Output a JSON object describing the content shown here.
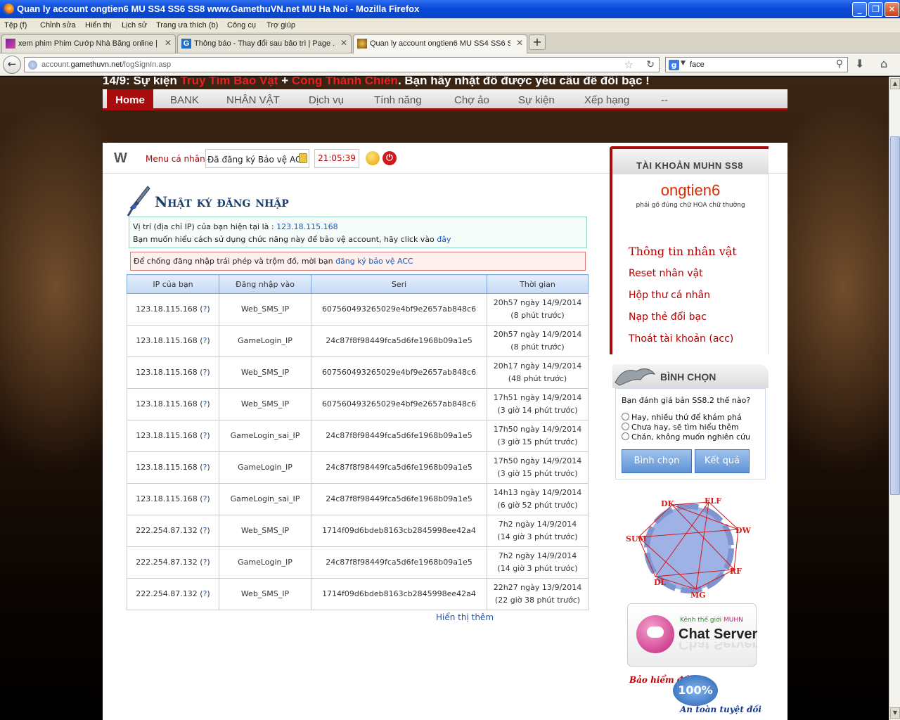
{
  "window": {
    "title": "Quan ly account ongtien6 MU SS4 SS6 SS8 www.GamethuVN.net MU Ha Noi - Mozilla Firefox",
    "min": "_",
    "max": "❐",
    "close": "✕"
  },
  "menubar": [
    "Tệp (f)",
    "Chỉnh sửa",
    "Hiển thị",
    "Lịch sử",
    "Trang ưa thích (b)",
    "Công cụ",
    "Trợ giúp"
  ],
  "tabs": [
    {
      "label": "xem phim Phim Cướp Nhà Băng online | T...",
      "close": "✕"
    },
    {
      "label": "Thông báo - Thay đổi sau bảo trì | Page ...",
      "close": "✕"
    },
    {
      "label": "Quan ly account ongtien6 MU SS4 SS6 SS...",
      "close": "✕"
    }
  ],
  "newtab": "+",
  "address": {
    "prefix": "account.",
    "domain": "gamethuvn.net",
    "path": "/logSignIn.asp"
  },
  "search": {
    "engine": "g",
    "query": "face"
  },
  "page": {
    "announce": {
      "part1": "14/9: Sự kiện ",
      "red1": "Truy Tìm Bảo Vật",
      "part2": " + ",
      "red2": "Công Thành Chiến",
      "part3": ". Bạn hãy nhặt đồ được yêu cầu để đổi bạc !"
    },
    "nav": [
      "Home",
      "BANK",
      "NHÂN VẬT",
      "Dịch vụ",
      "Tính năng",
      "Chợ ảo",
      "Sự kiện",
      "Xếp hạng",
      "--"
    ],
    "toolbar": {
      "logo": "W",
      "menu": "Menu cá nhân",
      "registered": "Đã đăng ký Bảo vệ ACC",
      "time": "21:05:39"
    },
    "section_title": "Nhật ký đăng nhập",
    "info": {
      "ip_text": "Vị trí (địa chỉ IP) của bạn hiện tại là : ",
      "ip": "123.18.115.168",
      "help_text": "Bạn muốn hiểu cách sử dụng chức năng này để bảo vệ account, hãy click vào ",
      "help_link": "đây",
      "warn_text": "Để chống đăng nhập trái phép và trộm đồ, mời bạn ",
      "warn_link": "đăng ký bảo vệ ACC"
    },
    "table": {
      "headers": [
        "IP của bạn",
        "Đăng nhập vào",
        "Seri",
        "Thời gian"
      ],
      "rows": [
        {
          "ip": "123.18.115.168",
          "q": "?",
          "target": "Web_SMS_IP",
          "seri": "607560493265029e4bf9e2657ab848c6",
          "time": "20h57 ngày 14/9/2014",
          "ago": "(8 phút trước)"
        },
        {
          "ip": "123.18.115.168",
          "q": "?",
          "target": "GameLogin_IP",
          "seri": "24c87f8f98449fca5d6fe1968b09a1e5",
          "time": "20h57 ngày 14/9/2014",
          "ago": "(8 phút trước)"
        },
        {
          "ip": "123.18.115.168",
          "q": "?",
          "target": "Web_SMS_IP",
          "seri": "607560493265029e4bf9e2657ab848c6",
          "time": "20h17 ngày 14/9/2014",
          "ago": "(48 phút trước)"
        },
        {
          "ip": "123.18.115.168",
          "q": "?",
          "target": "Web_SMS_IP",
          "seri": "607560493265029e4bf9e2657ab848c6",
          "time": "17h51 ngày 14/9/2014",
          "ago": "(3 giờ 14 phút trước)"
        },
        {
          "ip": "123.18.115.168",
          "q": "?",
          "target": "GameLogin_sai_IP",
          "seri": "24c87f8f98449fca5d6fe1968b09a1e5",
          "time": "17h50 ngày 14/9/2014",
          "ago": "(3 giờ 15 phút trước)"
        },
        {
          "ip": "123.18.115.168",
          "q": "?",
          "target": "GameLogin_IP",
          "seri": "24c87f8f98449fca5d6fe1968b09a1e5",
          "time": "17h50 ngày 14/9/2014",
          "ago": "(3 giờ 15 phút trước)"
        },
        {
          "ip": "123.18.115.168",
          "q": "?",
          "target": "GameLogin_sai_IP",
          "seri": "24c87f8f98449fca5d6fe1968b09a1e5",
          "time": "14h13 ngày 14/9/2014",
          "ago": "(6 giờ 52 phút trước)"
        },
        {
          "ip": "222.254.87.132",
          "q": "?",
          "target": "Web_SMS_IP",
          "seri": "1714f09d6bdeb8163cb2845998ee42a4",
          "time": "7h2 ngày 14/9/2014",
          "ago": "(14 giờ 3 phút trước)"
        },
        {
          "ip": "222.254.87.132",
          "q": "?",
          "target": "GameLogin_IP",
          "seri": "24c87f8f98449fca5d6fe1968b09a1e5",
          "time": "7h2 ngày 14/9/2014",
          "ago": "(14 giờ 3 phút trước)"
        },
        {
          "ip": "222.254.87.132",
          "q": "?",
          "target": "Web_SMS_IP",
          "seri": "1714f09d6bdeb8163cb2845998ee42a4",
          "time": "22h27 ngày 13/9/2014",
          "ago": "(22 giờ 38 phút trước)"
        }
      ]
    },
    "more": "Hiển thị thêm",
    "sidebar": {
      "account_title": "TÀI KHOẢN MUHN SS8",
      "username": "ongtien6",
      "note": "phải gõ đúng chữ HOA chữ thường",
      "links": [
        "Thông tin nhân vật",
        "Reset nhân vật",
        "Hộp thư cá nhân",
        "Nạp thẻ đổi bạc",
        "Thoát tài khoản (acc)"
      ],
      "vote_title": "BÌNH CHỌN",
      "vote_question": "Bạn đánh giá bản SS8.2 thế nào?",
      "vote_options": [
        "Hay, nhiều thứ để khám phá",
        "Chưa hay, sẽ tìm hiểu thêm",
        "Chán, không muốn nghiên cứu"
      ],
      "vote_button": "Bình chọn",
      "result_button": "Kết quả",
      "classes": [
        "DK",
        "ELF",
        "DW",
        "RF",
        "MG",
        "DL",
        "SUM"
      ],
      "chat_small_a": "Kênh thế giới ",
      "chat_small_b": "MUHN",
      "chat_big": "Chat Server",
      "insurance_top": "Bảo hiểm đồ",
      "insurance_pct": "100%",
      "insurance_bottom": "An toàn tuyệt đối"
    }
  },
  "colors": {
    "brand_red": "#a80c0c",
    "link_blue": "#1a56b0",
    "header_blue": "#c5d9f5"
  }
}
